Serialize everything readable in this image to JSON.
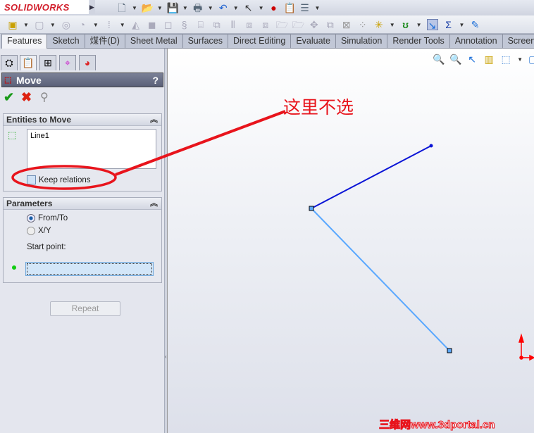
{
  "app": {
    "logo": "SOLIDWORKS"
  },
  "tabs": [
    "Features",
    "Sketch",
    "煤件(D)",
    "Sheet Metal",
    "Surfaces",
    "Direct Editing",
    "Evaluate",
    "Simulation",
    "Render Tools",
    "Annotation",
    "Screen"
  ],
  "property_manager": {
    "title": "Move",
    "help": "?",
    "entities_group": {
      "title": "Entities to Move",
      "list_value": "Line1",
      "keep_relations_label": "Keep relations",
      "keep_relations_checked": false
    },
    "parameters_group": {
      "title": "Parameters",
      "radio_from_to": "From/To",
      "radio_xy": "X/Y",
      "selected": "From/To",
      "start_point_label": "Start point:",
      "start_point_value": ""
    },
    "repeat_button": "Repeat"
  },
  "annotation": {
    "text": "这里不选",
    "color": "#e8141c"
  },
  "watermark": "三维网www.3dportal.cn",
  "colors": {
    "selected_line": "#0a14d6",
    "line": "#5aa8ff",
    "origin": "#ff0000"
  }
}
